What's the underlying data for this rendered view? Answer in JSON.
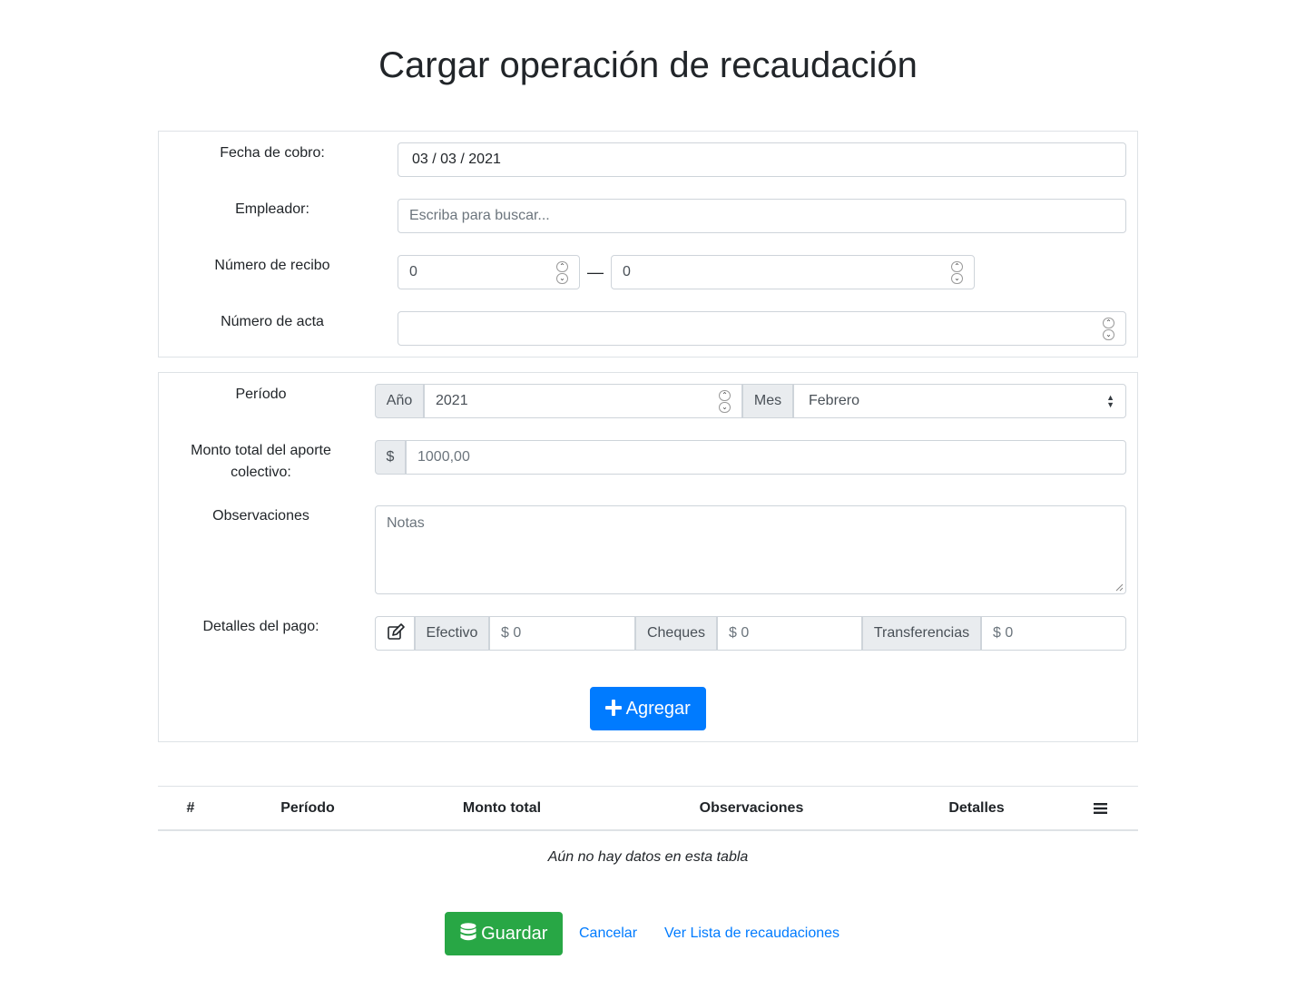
{
  "page": {
    "title": "Cargar operación de recaudación"
  },
  "form1": {
    "fecha_label": "Fecha de cobro:",
    "fecha_value": "03 / 03 / 2021",
    "empleador_label": "Empleador:",
    "empleador_placeholder": "Escriba para buscar...",
    "recibo_label": "Número de recibo",
    "recibo_from": "0",
    "recibo_sep": "—",
    "recibo_to": "0",
    "acta_label": "Número de acta",
    "acta_value": ""
  },
  "form2": {
    "periodo_label": "Período",
    "anio_addon": "Año",
    "anio_value": "2021",
    "mes_addon": "Mes",
    "mes_value": "Febrero",
    "monto_label": "Monto total del aporte colectivo:",
    "monto_addon": "$",
    "monto_value": "1000,00",
    "obs_label": "Observaciones",
    "obs_placeholder": "Notas",
    "detalles_label": "Detalles del pago:",
    "efectivo_addon": "Efectivo",
    "efectivo_value": "$ 0",
    "cheques_addon": "Cheques",
    "cheques_value": "$ 0",
    "transf_addon": "Transferencias",
    "transf_value": "$ 0",
    "add_button": "Agregar"
  },
  "table": {
    "headers": [
      "#",
      "Período",
      "Monto total",
      "Observaciones",
      "Detalles"
    ],
    "menu_icon": "bars-icon",
    "empty": "Aún no hay datos en esta tabla"
  },
  "footer": {
    "save_button": "Guardar",
    "cancel_link": "Cancelar",
    "list_link": "Ver Lista de recaudaciones"
  },
  "colors": {
    "primary": "#007bff",
    "success": "#28a745",
    "border": "#ced4da",
    "addon_bg": "#e9ecef"
  }
}
